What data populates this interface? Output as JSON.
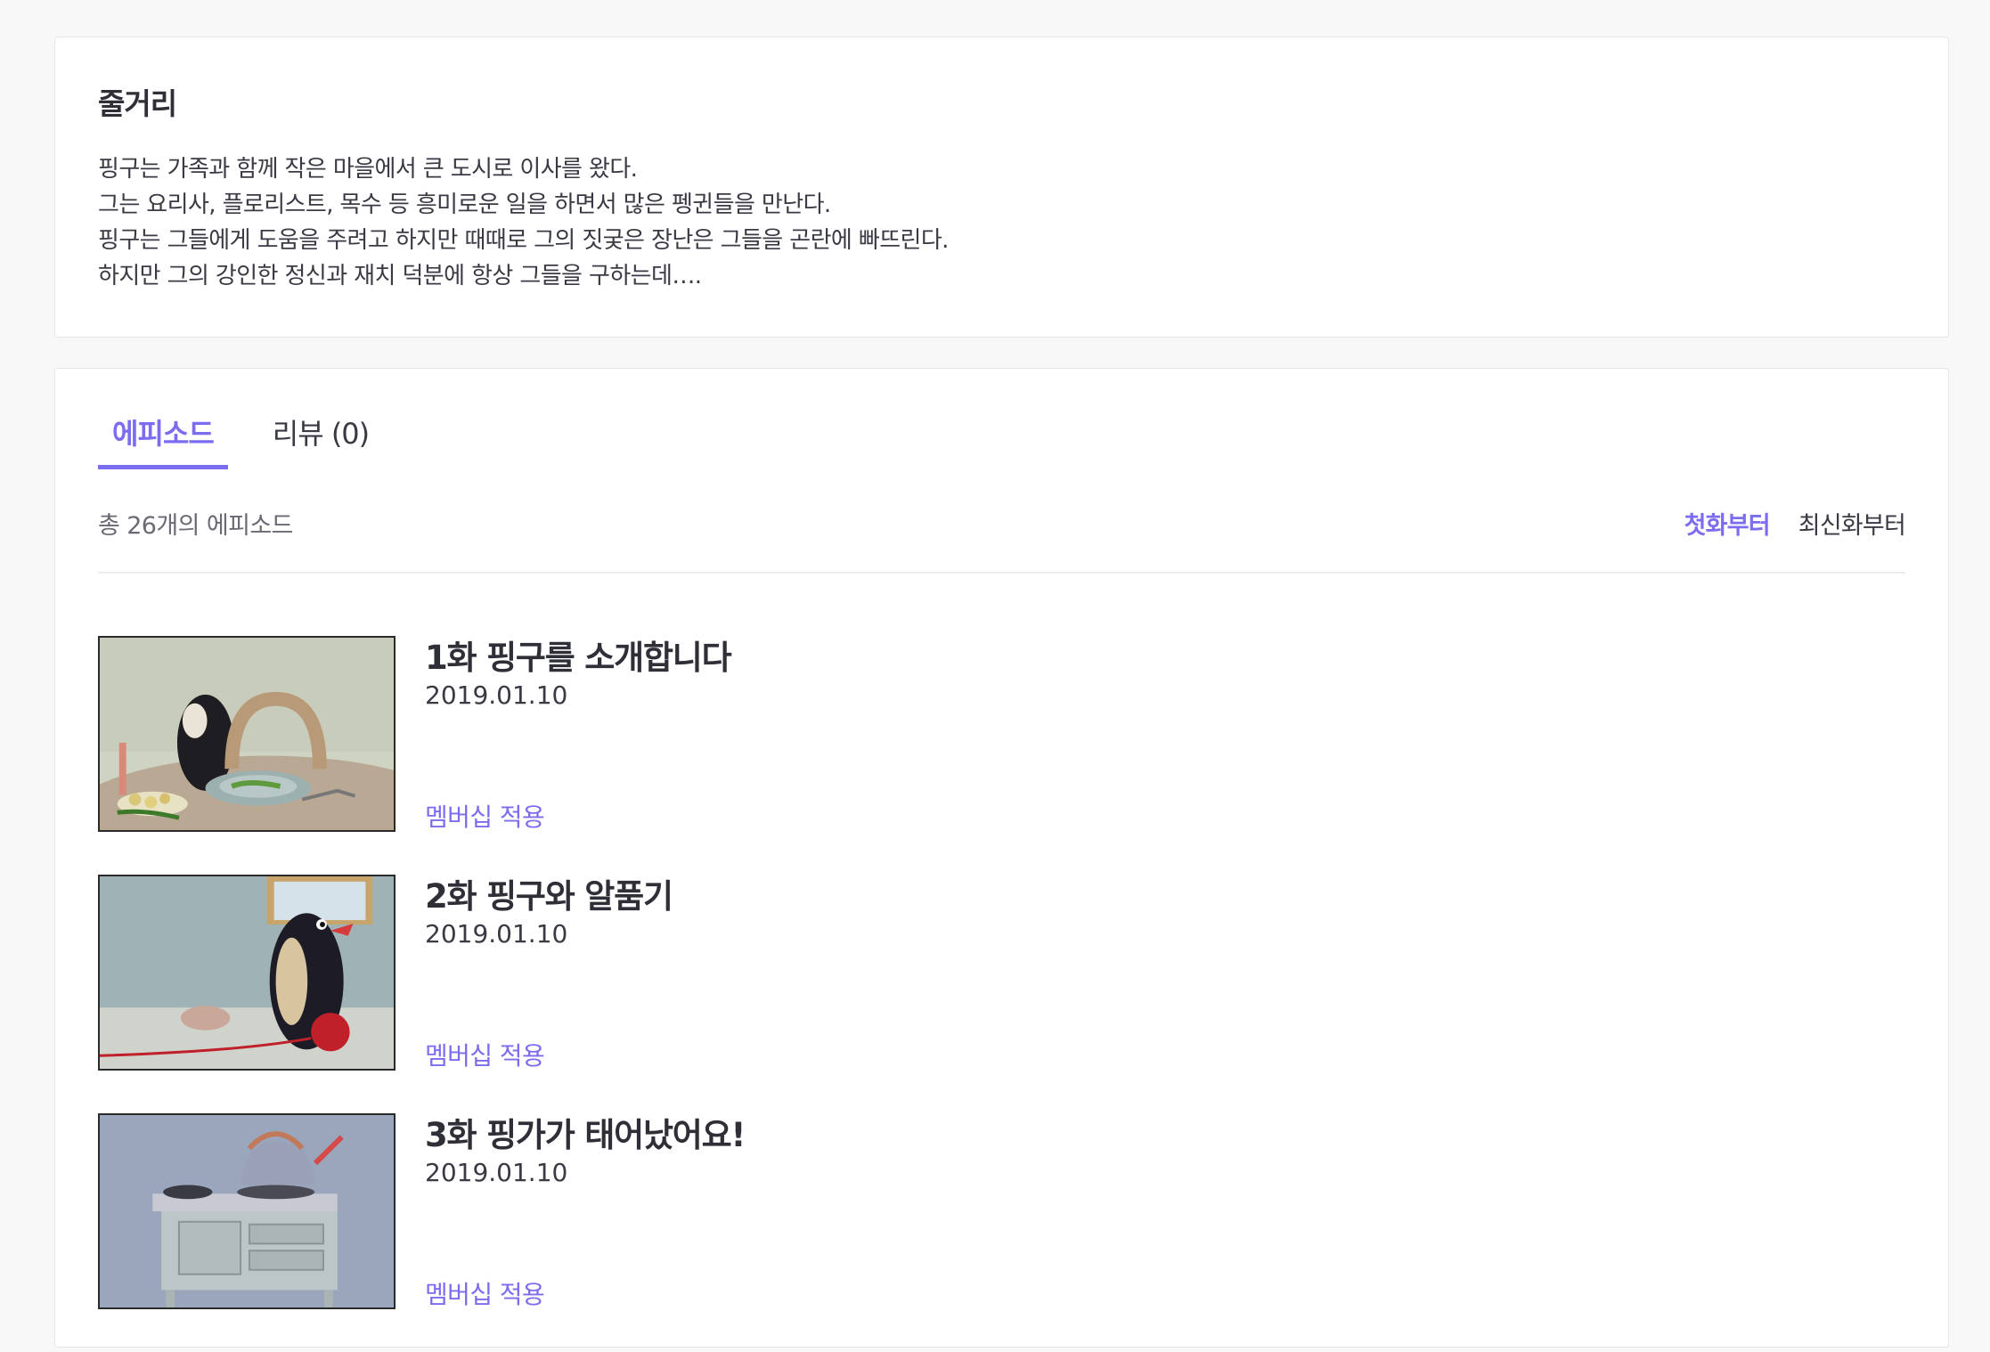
{
  "synopsis": {
    "title": "줄거리",
    "lines": [
      "핑구는 가족과 함께 작은 마을에서 큰 도시로 이사를 왔다.",
      "그는 요리사, 플로리스트, 목수 등 흥미로운 일을 하면서 많은 펭귄들을 만난다.",
      "핑구는 그들에게 도움을 주려고 하지만 때때로 그의 짓궂은 장난은 그들을 곤란에 빠뜨린다.",
      "하지만 그의 강인한 정신과 재치 덕분에 항상 그들을 구하는데….",
      ""
    ]
  },
  "tabs": [
    {
      "label": "에피소드",
      "active": true
    },
    {
      "label": "리뷰 (0)",
      "active": false
    }
  ],
  "episode_count": "총 26개의 에피소드",
  "sort": {
    "first": "첫화부터",
    "latest": "최신화부터",
    "selected": "first"
  },
  "episodes": [
    {
      "title": "1화 핑구를 소개합니다",
      "date": "2019.01.10",
      "badge": "멤버십 적용",
      "thumb_icon": "pingu-dinner-table-thumbnail"
    },
    {
      "title": "2화 핑구와 알품기",
      "date": "2019.01.10",
      "badge": "멤버십 적용",
      "thumb_icon": "pingu-yarn-ball-thumbnail"
    },
    {
      "title": "3화 핑가가 태어났어요!",
      "date": "2019.01.10",
      "badge": "멤버십 적용",
      "thumb_icon": "kettle-stove-thumbnail"
    }
  ],
  "colors": {
    "accent": "#7b6cf0",
    "text": "#333340",
    "muted": "#6a6a74",
    "background": "#f8f8f8",
    "card": "#ffffff"
  }
}
